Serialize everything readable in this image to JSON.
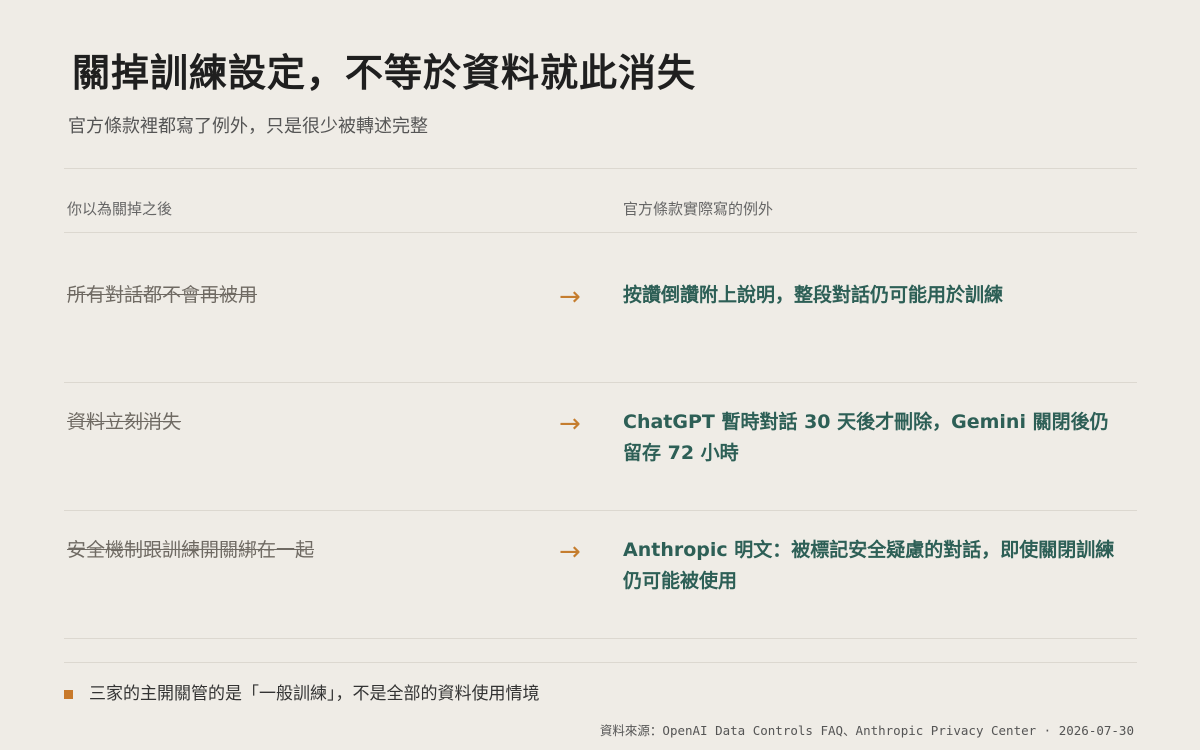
{
  "header": {
    "title": "關掉訓練設定，不等於資料就此消失",
    "subtitle": "官方條款裡都寫了例外，只是很少被轉述完整"
  },
  "columns": {
    "left": "你以為關掉之後",
    "right": "官方條款實際寫的例外"
  },
  "rows": [
    {
      "myth": "所有對話都不會再被用",
      "arrow": "→",
      "fact": "按讚倒讚附上說明，整段對話仍可能用於訓練"
    },
    {
      "myth": "資料立刻消失",
      "arrow": "→",
      "fact": "ChatGPT 暫時對話 30 天後才刪除，Gemini 關閉後仍留存 72 小時"
    },
    {
      "myth": "安全機制跟訓練開關綁在一起",
      "arrow": "→",
      "fact": "Anthropic 明文：被標記安全疑慮的對話，即使關閉訓練仍可能被使用"
    }
  ],
  "footer": {
    "note": "三家的主開關管的是「一般訓練」，不是全部的資料使用情境",
    "source": "資料來源：OpenAI Data Controls FAQ、Anthropic Privacy Center · 2026-07-30"
  },
  "colors": {
    "background": "#efece6",
    "accent": "#c57d2e",
    "fact_text": "#2d5f56",
    "myth_text": "#6f6a63"
  }
}
